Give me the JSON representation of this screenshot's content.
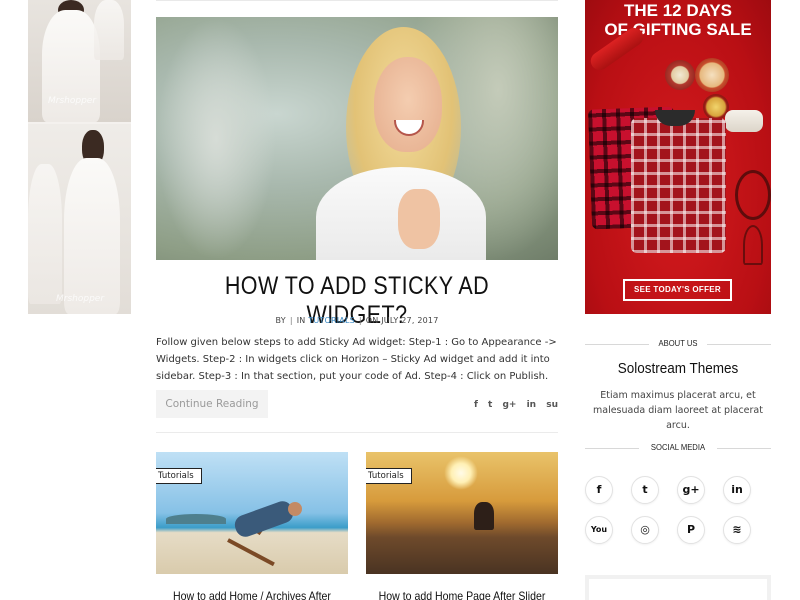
{
  "left_ad": {
    "watermark": "Mrshopper"
  },
  "hero_post": {
    "title": "HOW TO ADD STICKY AD WIDGET?",
    "meta": {
      "by_label": "BY",
      "separator": "|",
      "in_label": "IN",
      "category": "TUTORIALS",
      "date": "ON JULY 27, 2017"
    },
    "excerpt": "Follow given below steps to add Sticky Ad widget: Step-1 : Go to Appearance -> Widgets. Step-2 : In widgets click on Horizon – Sticky Ad widget and add it into sidebar. Step-3 : In that section, put your code of Ad. Step-4 : Click on Publish.",
    "continue_label": "Continue Reading",
    "share_icons": [
      {
        "icon": "facebook-icon",
        "glyph": "f"
      },
      {
        "icon": "twitter-icon",
        "glyph": "t"
      },
      {
        "icon": "google-plus-icon",
        "glyph": "g+"
      },
      {
        "icon": "linkedin-icon",
        "glyph": "in"
      },
      {
        "icon": "stumbleupon-icon",
        "glyph": "su"
      }
    ]
  },
  "grid_posts": [
    {
      "tag": "Tutorials",
      "title": "How to add Home / Archives After Grid Post"
    },
    {
      "tag": "Tutorials",
      "title": "How to add Home Page After Slider Section"
    }
  ],
  "right_ad": {
    "headline_line1": "THE 12 DAYS",
    "headline_line2": "OF GIFTING SALE",
    "cta": "SEE TODAY'S OFFER",
    "accent_color": "#c8102e"
  },
  "about_widget": {
    "heading": "ABOUT US",
    "name": "Solostream Themes",
    "text": "Etiam maximus placerat arcu, et malesuada diam laoreet at placerat arcu."
  },
  "social_widget": {
    "heading": "SOCIAL MEDIA",
    "icons": [
      {
        "icon": "facebook-icon",
        "glyph": "f"
      },
      {
        "icon": "twitter-icon",
        "glyph": "t"
      },
      {
        "icon": "google-plus-icon",
        "glyph": "g+"
      },
      {
        "icon": "linkedin-icon",
        "glyph": "in"
      },
      {
        "icon": "youtube-icon",
        "glyph": "You"
      },
      {
        "icon": "instagram-icon",
        "glyph": "◎"
      },
      {
        "icon": "pinterest-icon",
        "glyph": "P"
      },
      {
        "icon": "rss-icon",
        "glyph": "≋"
      }
    ]
  }
}
